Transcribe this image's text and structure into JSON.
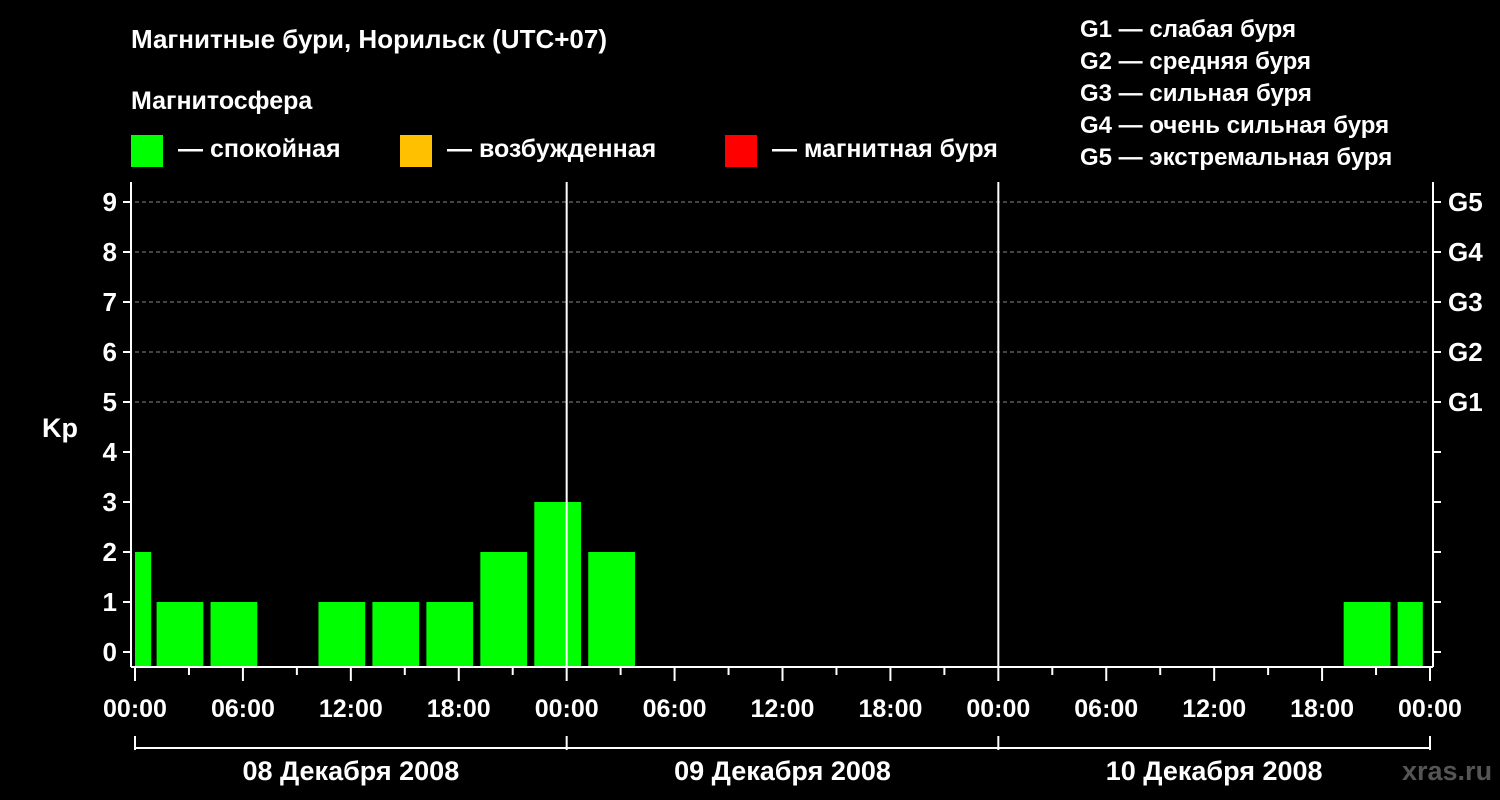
{
  "title": "Магнитные бури, Норильск (UTC+07)",
  "subtitle": "Магнитосфера",
  "legend": [
    {
      "color": "#00ff00",
      "label": "— спокойная"
    },
    {
      "color": "#ffc000",
      "label": "— возбужденная"
    },
    {
      "color": "#ff0000",
      "label": "— магнитная буря"
    }
  ],
  "g_scale_legend": [
    "G1 — слабая буря",
    "G2 — средняя буря",
    "G3 — сильная буря",
    "G4 — очень сильная буря",
    "G5 — экстремальная буря"
  ],
  "watermark": "xras.ru",
  "chart_data": {
    "type": "bar",
    "ylabel": "Kp",
    "ylim": [
      0,
      9
    ],
    "yticks": [
      "0",
      "1",
      "2",
      "3",
      "4",
      "5",
      "6",
      "7",
      "8",
      "9"
    ],
    "right_ticks": [
      {
        "kp": 5,
        "label": "G1"
      },
      {
        "kp": 6,
        "label": "G2"
      },
      {
        "kp": 7,
        "label": "G3"
      },
      {
        "kp": 8,
        "label": "G4"
      },
      {
        "kp": 9,
        "label": "G5"
      }
    ],
    "x_hours_range": [
      0,
      72
    ],
    "xtick_labels": [
      "00:00",
      "06:00",
      "12:00",
      "18:00",
      "00:00",
      "06:00",
      "12:00",
      "18:00",
      "00:00",
      "06:00",
      "12:00",
      "18:00",
      "00:00"
    ],
    "days": [
      "08 Декабря 2008",
      "09 Декабря 2008",
      "10 Декабря 2008"
    ],
    "bar_color": "#00ff00",
    "series": [
      {
        "start_hour": 0,
        "end_hour": 0.9,
        "kp": 2
      },
      {
        "start_hour": 1.2,
        "end_hour": 3.8,
        "kp": 1
      },
      {
        "start_hour": 4.2,
        "end_hour": 6.8,
        "kp": 1
      },
      {
        "start_hour": 10.2,
        "end_hour": 12.8,
        "kp": 1
      },
      {
        "start_hour": 13.2,
        "end_hour": 15.8,
        "kp": 1
      },
      {
        "start_hour": 16.2,
        "end_hour": 18.8,
        "kp": 1
      },
      {
        "start_hour": 19.2,
        "end_hour": 21.8,
        "kp": 2
      },
      {
        "start_hour": 22.2,
        "end_hour": 24.8,
        "kp": 3
      },
      {
        "start_hour": 25.2,
        "end_hour": 27.8,
        "kp": 2
      },
      {
        "start_hour": 67.2,
        "end_hour": 69.8,
        "kp": 1
      },
      {
        "start_hour": 70.2,
        "end_hour": 71.6,
        "kp": 1
      }
    ],
    "grid": "dashed horizontal lines at each Kp level from 5 to 9; solid vertical lines at each day boundary"
  }
}
